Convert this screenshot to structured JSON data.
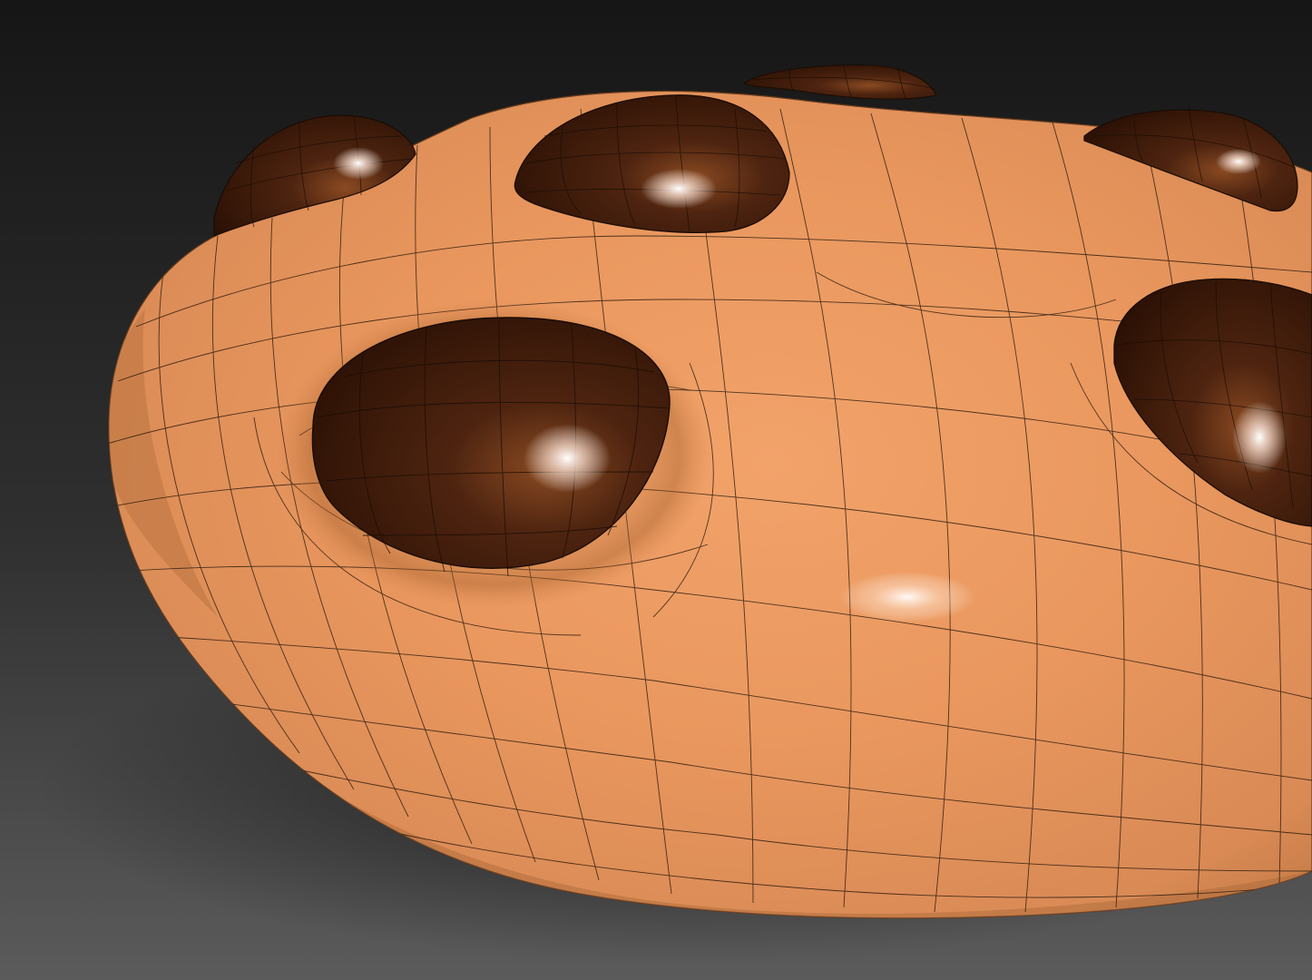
{
  "viewport": {
    "background_top": "#161616",
    "background_bottom": "#5b5b5b"
  },
  "model": {
    "name": "cookie-mesh",
    "dough_color": "#e8965f",
    "dough_shadow_color": "#9a5a2e",
    "chip_color": "#3a1a08",
    "chip_highlight_color": "#ffffff",
    "wire_color": "#1a1008",
    "chip_count": 6,
    "shading": "smooth-with-wireframe-overlay"
  }
}
